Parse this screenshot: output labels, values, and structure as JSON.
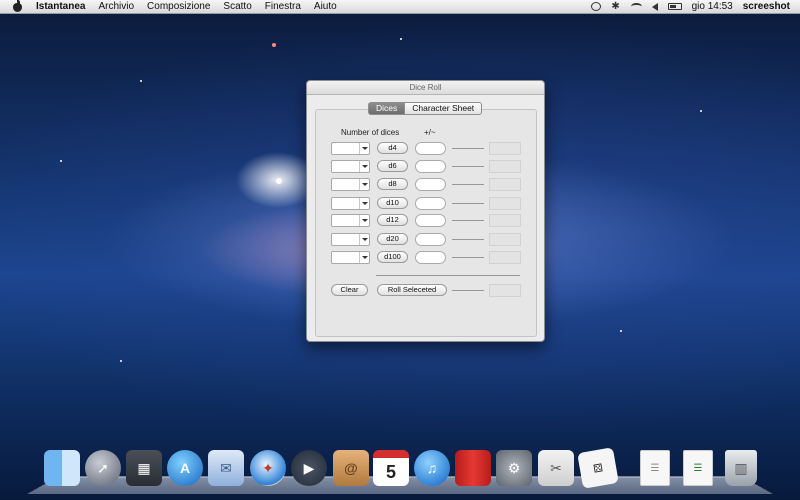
{
  "menubar": {
    "app_name": "Istantanea",
    "menus": [
      "Archivio",
      "Composizione",
      "Scatto",
      "Finestra",
      "Aiuto"
    ],
    "clock": "gio 14:53",
    "user": "screeshot"
  },
  "window": {
    "title": "Dice Roll",
    "tabs": [
      {
        "label": "Dices",
        "selected": true
      },
      {
        "label": "Character Sheet",
        "selected": false
      }
    ],
    "headers": {
      "number_of_dices": "Number of dices",
      "modifier": "+/~"
    },
    "dice": [
      "d4",
      "d6",
      "d8",
      "d10",
      "d12",
      "d20",
      "d100"
    ],
    "buttons": {
      "clear": "Clear",
      "roll_selected": "Roll Seleceted"
    }
  },
  "dock": {
    "apps": [
      "finder-icon",
      "launchpad-icon",
      "mission-control-icon",
      "app-store-icon",
      "mail-icon",
      "safari-icon",
      "facetime-icon",
      "address-book-icon",
      "ical-icon",
      "itunes-icon",
      "photo-booth-icon",
      "system-preferences-icon",
      "preview-icon",
      "dice-roll-icon",
      "document-icon",
      "document-icon",
      "trash-icon"
    ],
    "ical_day": "5"
  },
  "colors": {
    "tab_active": "#7a7a7a",
    "window_bg": "#ececec",
    "desktop": "#14346e"
  }
}
